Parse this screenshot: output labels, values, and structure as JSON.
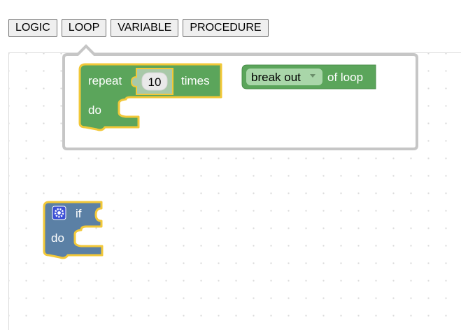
{
  "toolbar": {
    "categories": [
      {
        "label": "LOGIC"
      },
      {
        "label": "LOOP"
      },
      {
        "label": "VARIABLE"
      },
      {
        "label": "PROCEDURE"
      }
    ]
  },
  "flyout": {
    "repeat_block": {
      "label_repeat": "repeat",
      "count_value": "10",
      "label_times": "times",
      "label_do": "do"
    },
    "break_block": {
      "dropdown_value": "break out",
      "label_suffix": "of loop"
    }
  },
  "workspace": {
    "if_block": {
      "label_if": "if",
      "label_do": "do"
    }
  },
  "colors": {
    "loop_green": "#5ba55b",
    "logic_blue": "#5b80a5",
    "highlight_yellow": "#f2c839",
    "flyout_border": "#c6c6c6"
  },
  "icons": {
    "dropdown_arrow": "triangle-down",
    "mutator": "gear-icon"
  }
}
